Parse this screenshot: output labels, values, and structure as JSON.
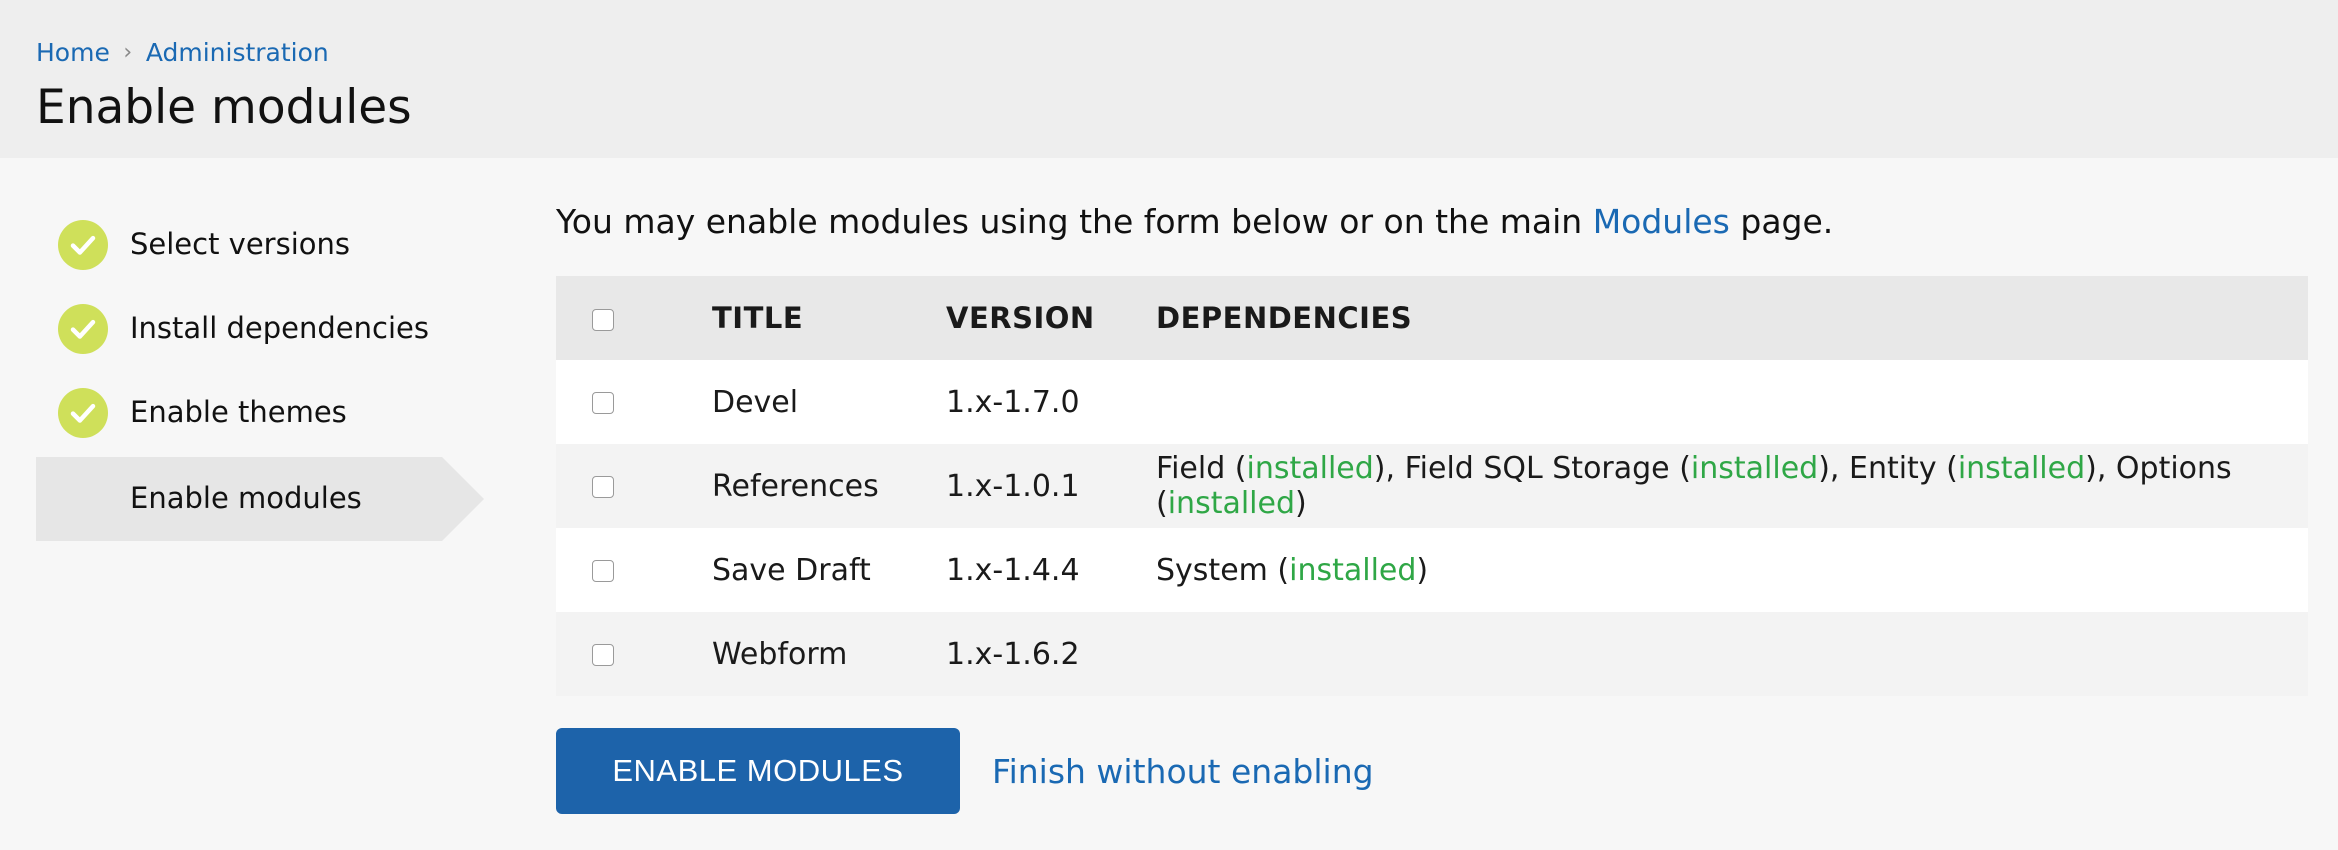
{
  "breadcrumb": {
    "home": "Home",
    "administration": "Administration"
  },
  "page_title": "Enable modules",
  "steps": [
    {
      "label": "Select versions",
      "status": "complete"
    },
    {
      "label": "Install dependencies",
      "status": "complete"
    },
    {
      "label": "Enable themes",
      "status": "complete"
    },
    {
      "label": "Enable modules",
      "status": "active"
    }
  ],
  "intro": {
    "before": "You may enable modules using the form below or on the main ",
    "link": "Modules",
    "after": " page."
  },
  "table": {
    "headers": {
      "title": "TITLE",
      "version": "VERSION",
      "dependencies": "DEPENDENCIES"
    },
    "rows": [
      {
        "title": "Devel",
        "version": "1.x-1.7.0",
        "deps": []
      },
      {
        "title": "References",
        "version": "1.x-1.0.1",
        "deps": [
          {
            "name": "Field",
            "status": "installed"
          },
          {
            "name": "Field SQL Storage",
            "status": "installed"
          },
          {
            "name": "Entity",
            "status": "installed"
          },
          {
            "name": "Options",
            "status": "installed"
          }
        ]
      },
      {
        "title": "Save Draft",
        "version": "1.x-1.4.4",
        "deps": [
          {
            "name": "System",
            "status": "installed"
          }
        ]
      },
      {
        "title": "Webform",
        "version": "1.x-1.6.2",
        "deps": []
      }
    ]
  },
  "actions": {
    "enable_label": "ENABLE MODULES",
    "finish_label": "Finish without enabling"
  },
  "colors": {
    "link": "#1a69b3",
    "installed": "#2fa746",
    "check": "#cfe05a",
    "button": "#1d63aa"
  },
  "icons": {
    "step_complete": "check-circle-icon",
    "breadcrumb_separator": "chevron-right-icon"
  }
}
